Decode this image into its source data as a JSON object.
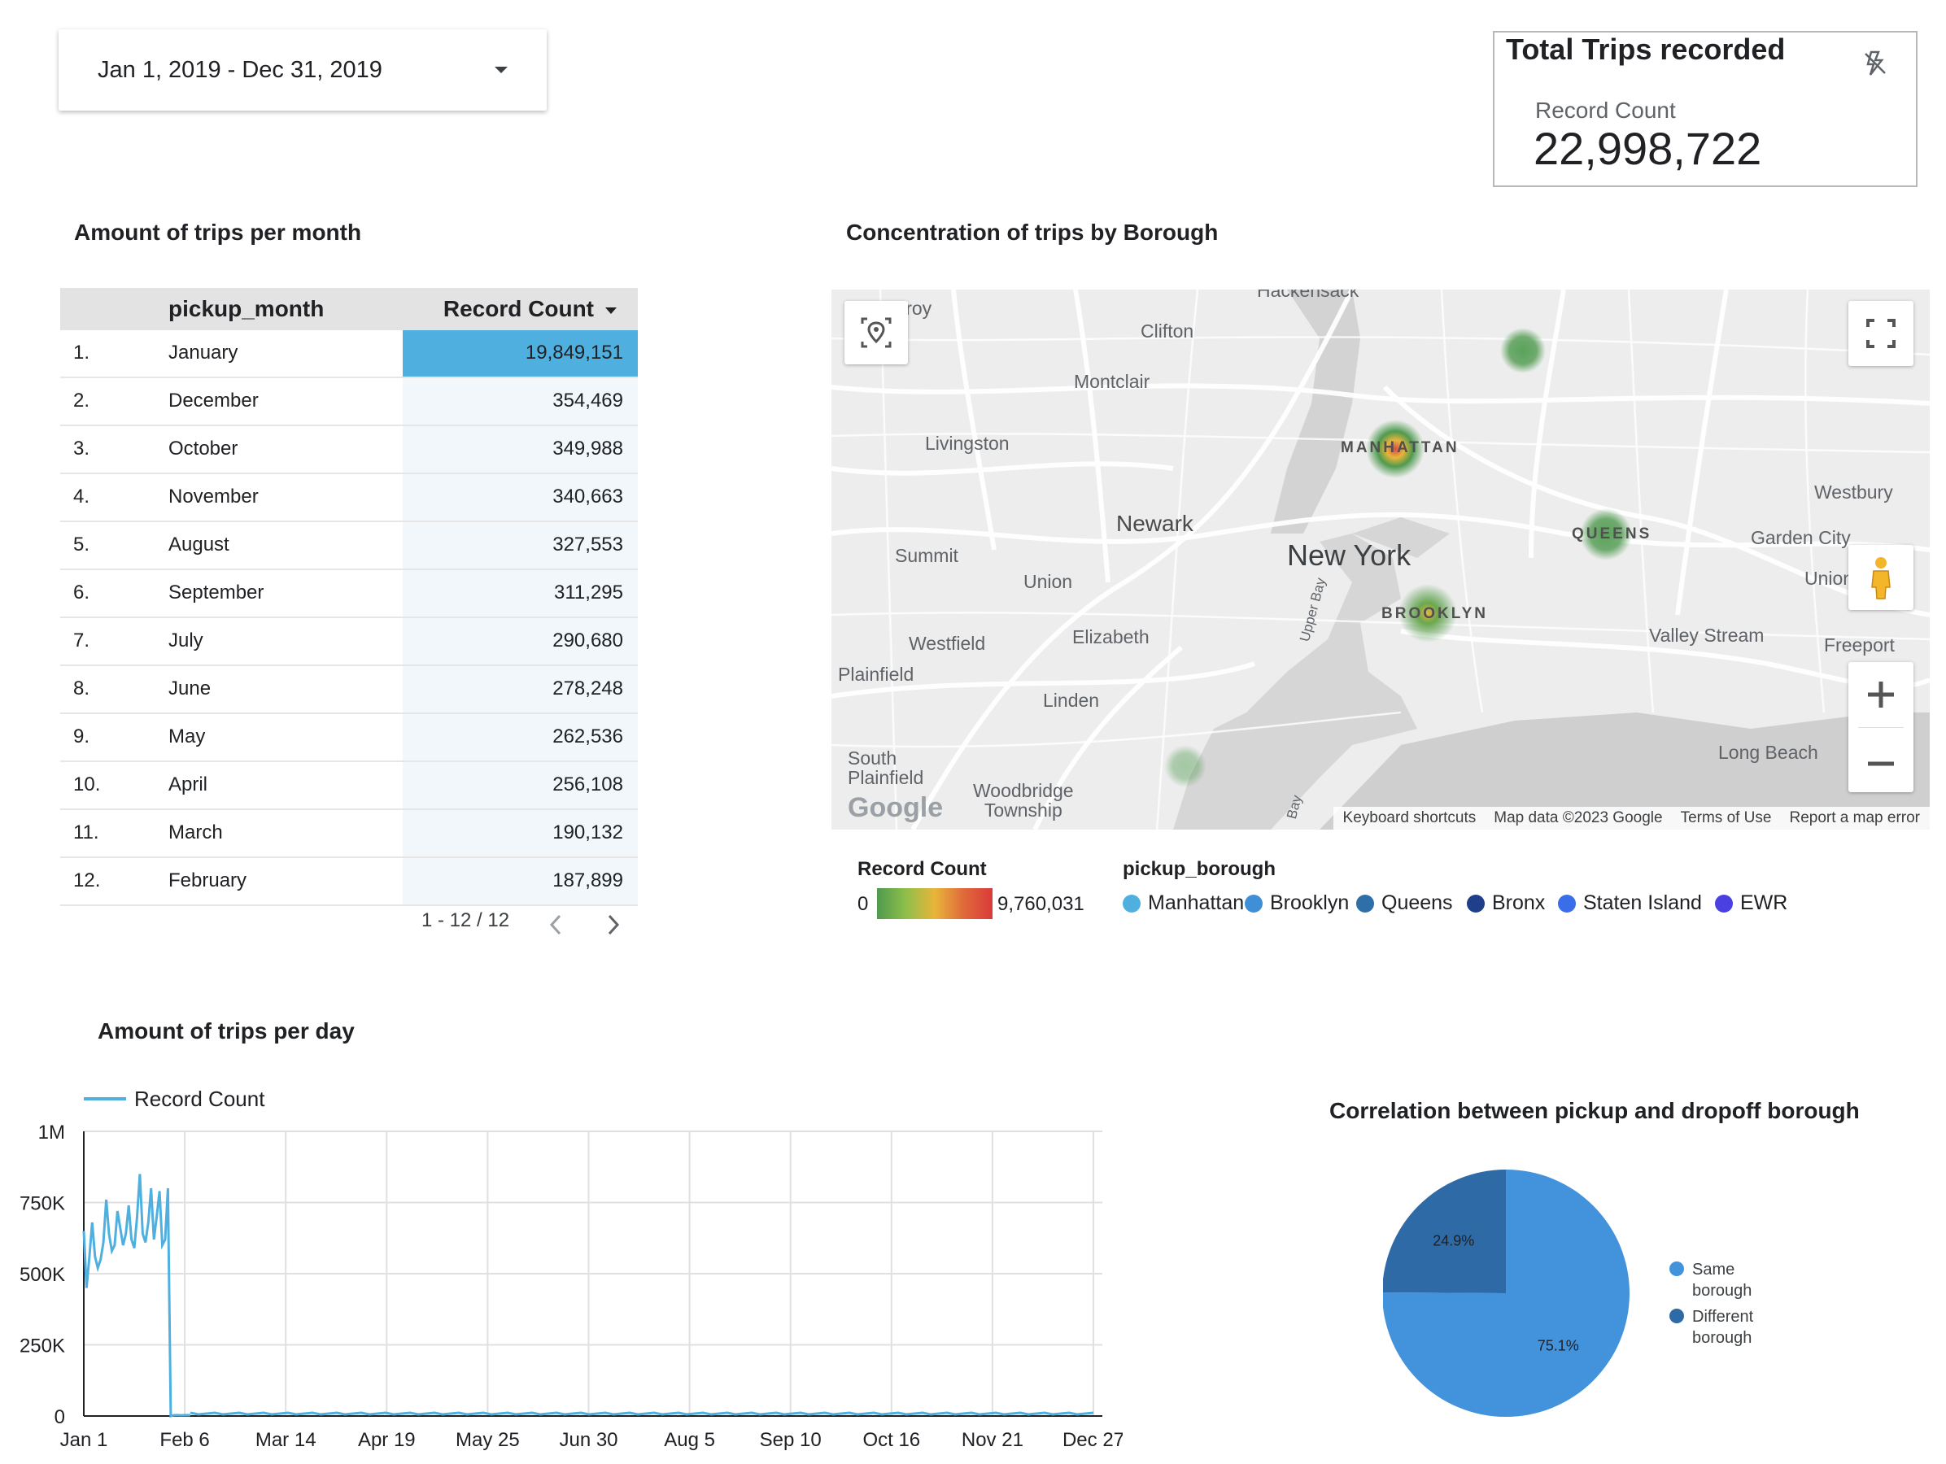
{
  "date_range": {
    "label": "Jan 1, 2019 - Dec 31, 2019"
  },
  "scorecard": {
    "title": "Total Trips recorded",
    "metric_label": "Record Count",
    "value": "22,998,722"
  },
  "table": {
    "title": "Amount of trips per month",
    "columns": [
      "pickup_month",
      "Record Count"
    ],
    "rows": [
      {
        "idx": "1.",
        "month": "January",
        "value": "19,849,151"
      },
      {
        "idx": "2.",
        "month": "December",
        "value": "354,469"
      },
      {
        "idx": "3.",
        "month": "October",
        "value": "349,988"
      },
      {
        "idx": "4.",
        "month": "November",
        "value": "340,663"
      },
      {
        "idx": "5.",
        "month": "August",
        "value": "327,553"
      },
      {
        "idx": "6.",
        "month": "September",
        "value": "311,295"
      },
      {
        "idx": "7.",
        "month": "July",
        "value": "290,680"
      },
      {
        "idx": "8.",
        "month": "June",
        "value": "278,248"
      },
      {
        "idx": "9.",
        "month": "May",
        "value": "262,536"
      },
      {
        "idx": "10.",
        "month": "April",
        "value": "256,108"
      },
      {
        "idx": "11.",
        "month": "March",
        "value": "190,132"
      },
      {
        "idx": "12.",
        "month": "February",
        "value": "187,899"
      }
    ],
    "pagination": "1 - 12 / 12"
  },
  "map": {
    "title": "Concentration of trips by Borough",
    "places": {
      "hackensack": "Hackensack",
      "troy": "Troy",
      "clifton": "Clifton",
      "montclair": "Montclair",
      "livingston": "Livingston",
      "newark": "Newark",
      "new_york": "New York",
      "summit": "Summit",
      "union": "Union",
      "westbury": "Westbury",
      "garden_city": "Garden City",
      "union2": "Union",
      "westfield": "Westfield",
      "elizabeth": "Elizabeth",
      "valley_stream": "Valley Stream",
      "freeport": "Freeport",
      "plainfield": "Plainfield",
      "linden": "Linden",
      "south_plainfield": "South\nPlainfield",
      "woodbridge": "Woodbridge\nTownship",
      "long_beach": "Long Beach",
      "upper_bay": "Upper Bay",
      "bay": "Bay",
      "manhattan": "MANHATTAN",
      "queens": "QUEENS",
      "brooklyn": "BROOKLYN"
    },
    "footer": [
      "Keyboard shortcuts",
      "Map data ©2023 Google",
      "Terms of Use",
      "Report a map error"
    ],
    "google_logo": "Google"
  },
  "map_legend": {
    "gradient_title": "Record Count",
    "gradient_min": "0",
    "gradient_max": "9,760,031",
    "category_title": "pickup_borough",
    "categories": [
      {
        "name": "Manhattan",
        "color": "#4fb0e0"
      },
      {
        "name": "Brooklyn",
        "color": "#3f8fd6"
      },
      {
        "name": "Queens",
        "color": "#2f6fa8"
      },
      {
        "name": "Bronx",
        "color": "#1f3f8a"
      },
      {
        "name": "Staten Island",
        "color": "#3a6ee8"
      },
      {
        "name": "EWR",
        "color": "#4a3fe0"
      }
    ]
  },
  "chart_data": [
    {
      "type": "line",
      "title": "Amount of trips per day",
      "legend": "Record Count",
      "color": "#4fb0e0",
      "ylim": [
        0,
        1000000
      ],
      "y_ticks": [
        "0",
        "250K",
        "500K",
        "750K",
        "1M"
      ],
      "x_ticks": [
        "Jan 1",
        "Feb 6",
        "Mar 14",
        "Apr 19",
        "May 25",
        "Jun 30",
        "Aug 5",
        "Sep 10",
        "Oct 16",
        "Nov 21",
        "Dec 27"
      ],
      "series": [
        {
          "name": "Record Count",
          "x_start": "2019-01-01",
          "values": [
            650000,
            450000,
            560000,
            680000,
            560000,
            520000,
            550000,
            610000,
            760000,
            640000,
            580000,
            600000,
            720000,
            660000,
            600000,
            640000,
            740000,
            620000,
            590000,
            700000,
            850000,
            640000,
            610000,
            680000,
            800000,
            620000,
            700000,
            790000,
            600000,
            620000,
            800000,
            0,
            2500,
            3000,
            2800,
            2600,
            3100,
            2900,
            3000
          ]
        }
      ]
    },
    {
      "type": "pie",
      "title": "Correlation between pickup and dropoff borough",
      "slices": [
        {
          "label": "Same borough",
          "value": 75.1,
          "color": "#4293dc",
          "text": "75.1%"
        },
        {
          "label": "Different borough",
          "value": 24.9,
          "color": "#2d6aa6",
          "text": "24.9%"
        }
      ]
    }
  ]
}
